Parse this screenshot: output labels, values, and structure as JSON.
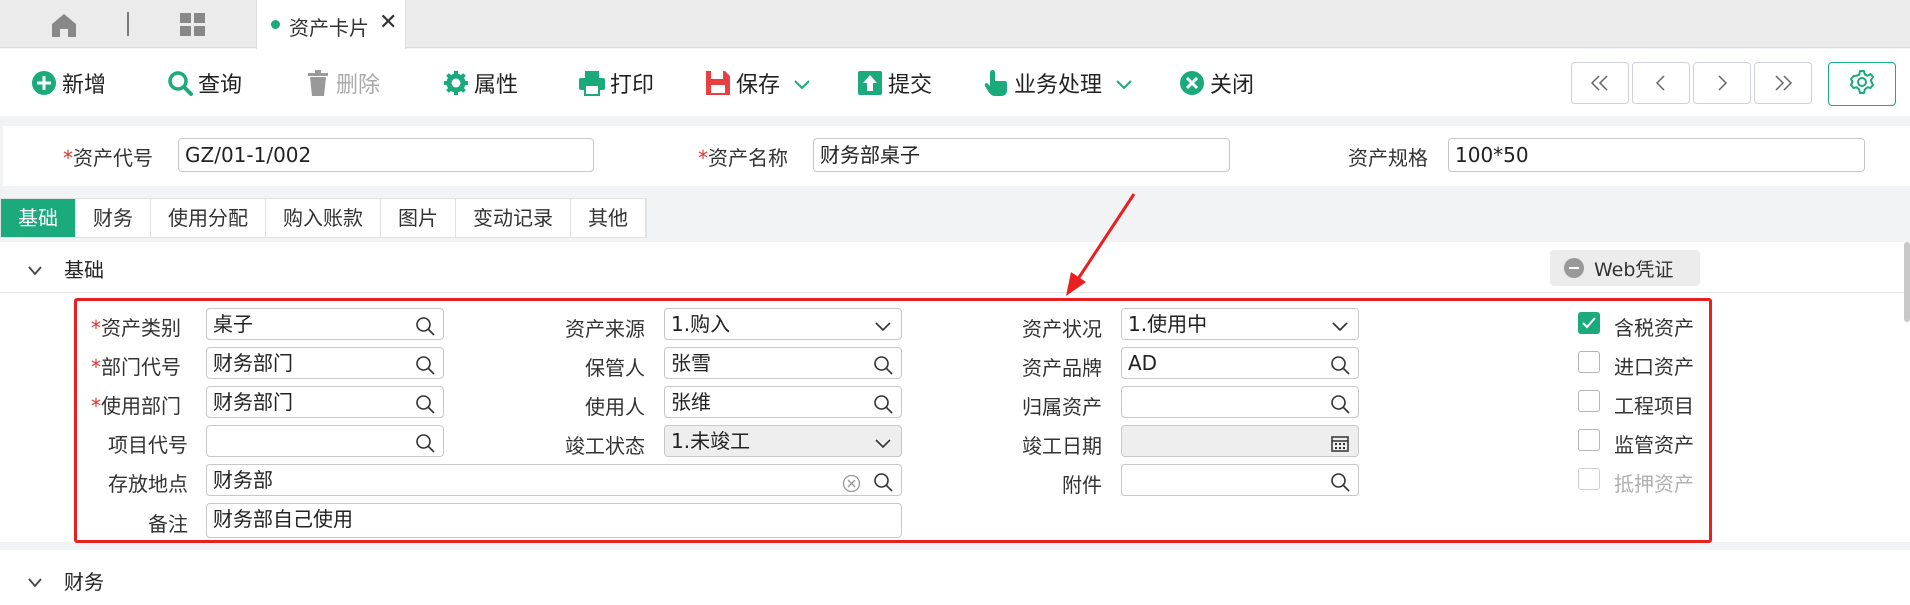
{
  "tab": {
    "label": "资产卡片"
  },
  "toolbar": {
    "add": "新增",
    "query": "查询",
    "delete": "删除",
    "properties": "属性",
    "print": "打印",
    "save": "保存",
    "submit": "提交",
    "business": "业务处理",
    "close": "关闭"
  },
  "header": {
    "code_label": "资产代号",
    "code_value": "GZ/01-1/002",
    "name_label": "资产名称",
    "name_value": "财务部桌子",
    "spec_label": "资产规格",
    "spec_value": "100*50"
  },
  "subtabs": [
    "基础",
    "财务",
    "使用分配",
    "购入账款",
    "图片",
    "变动记录",
    "其他"
  ],
  "section_basic": {
    "title": "基础",
    "web_voucher": "Web凭证",
    "fields": {
      "category_label": "资产类别",
      "category_value": "桌子",
      "dept_code_label": "部门代号",
      "dept_code_value": "财务部门",
      "use_dept_label": "使用部门",
      "use_dept_value": "财务部门",
      "project_label": "项目代号",
      "project_value": "",
      "location_label": "存放地点",
      "location_value": "财务部",
      "remark_label": "备注",
      "remark_value": "财务部自己使用",
      "source_label": "资产来源",
      "source_value": "1.购入",
      "keeper_label": "保管人",
      "keeper_value": "张雪",
      "user_label": "使用人",
      "user_value": "张维",
      "completion_label": "竣工状态",
      "completion_value": "1.未竣工",
      "status_label": "资产状况",
      "status_value": "1.使用中",
      "brand_label": "资产品牌",
      "brand_value": "AD",
      "parent_label": "归属资产",
      "parent_value": "",
      "completion_date_label": "竣工日期",
      "completion_date_value": "",
      "attachment_label": "附件",
      "attachment_value": ""
    },
    "checkboxes": [
      {
        "label": "含税资产",
        "checked": true,
        "disabled": false
      },
      {
        "label": "进口资产",
        "checked": false,
        "disabled": false
      },
      {
        "label": "工程项目",
        "checked": false,
        "disabled": false
      },
      {
        "label": "监管资产",
        "checked": false,
        "disabled": false
      },
      {
        "label": "抵押资产",
        "checked": false,
        "disabled": true
      }
    ]
  },
  "section_finance": {
    "title": "财务"
  },
  "colors": {
    "accent": "#1aaa7c",
    "annotation_red": "#e82020"
  }
}
